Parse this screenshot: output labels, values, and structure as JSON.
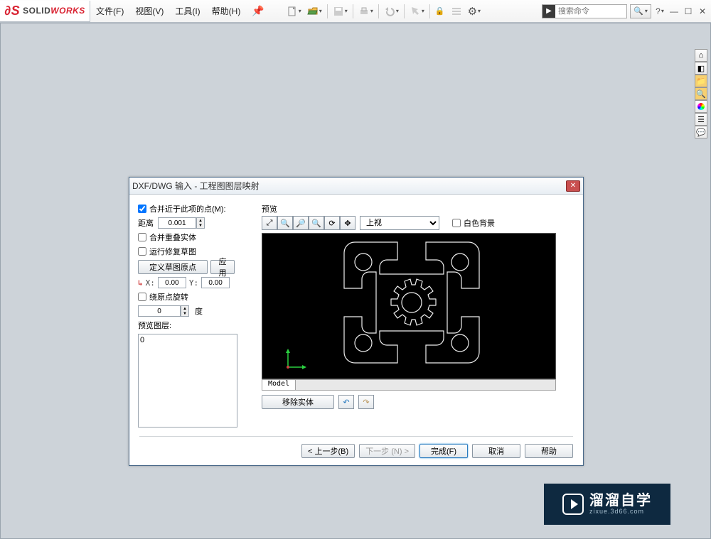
{
  "app": {
    "name_sol": "SOLID",
    "name_works": "WORKS"
  },
  "menu": {
    "file": "文件(F)",
    "view": "视图(V)",
    "tools": "工具(I)",
    "help": "帮助(H)"
  },
  "search": {
    "placeholder": "搜索命令"
  },
  "dialog": {
    "title": "DXF/DWG 输入 - 工程图图层映射",
    "merge_close_points": "合并近于此项的点(M):",
    "distance_label": "距离",
    "distance_value": "0.001",
    "merge_overlap": "合并重叠实体",
    "run_repair": "运行修复草图",
    "define_origin": "定义草图原点",
    "apply": "应用",
    "x_label": "X:",
    "y_label": "Y:",
    "x_value": "0.00",
    "y_value": "0.00",
    "rotate_origin": "绕原点旋转",
    "rotate_value": "0",
    "degree": "度",
    "preview_layers": "预览图层:",
    "layer0": "0",
    "preview": "预览",
    "view_select": "上视",
    "white_bg": "白色背景",
    "tab_model": "Model",
    "remove_entities": "移除实体",
    "prev_btn": "< 上一步(B)",
    "next_btn": "下一步 (N) >",
    "finish_btn": "完成(F)",
    "cancel_btn": "取消",
    "help_btn": "帮助"
  },
  "watermark": {
    "main": "溜溜自学",
    "sub": "zixue.3d66.com"
  }
}
